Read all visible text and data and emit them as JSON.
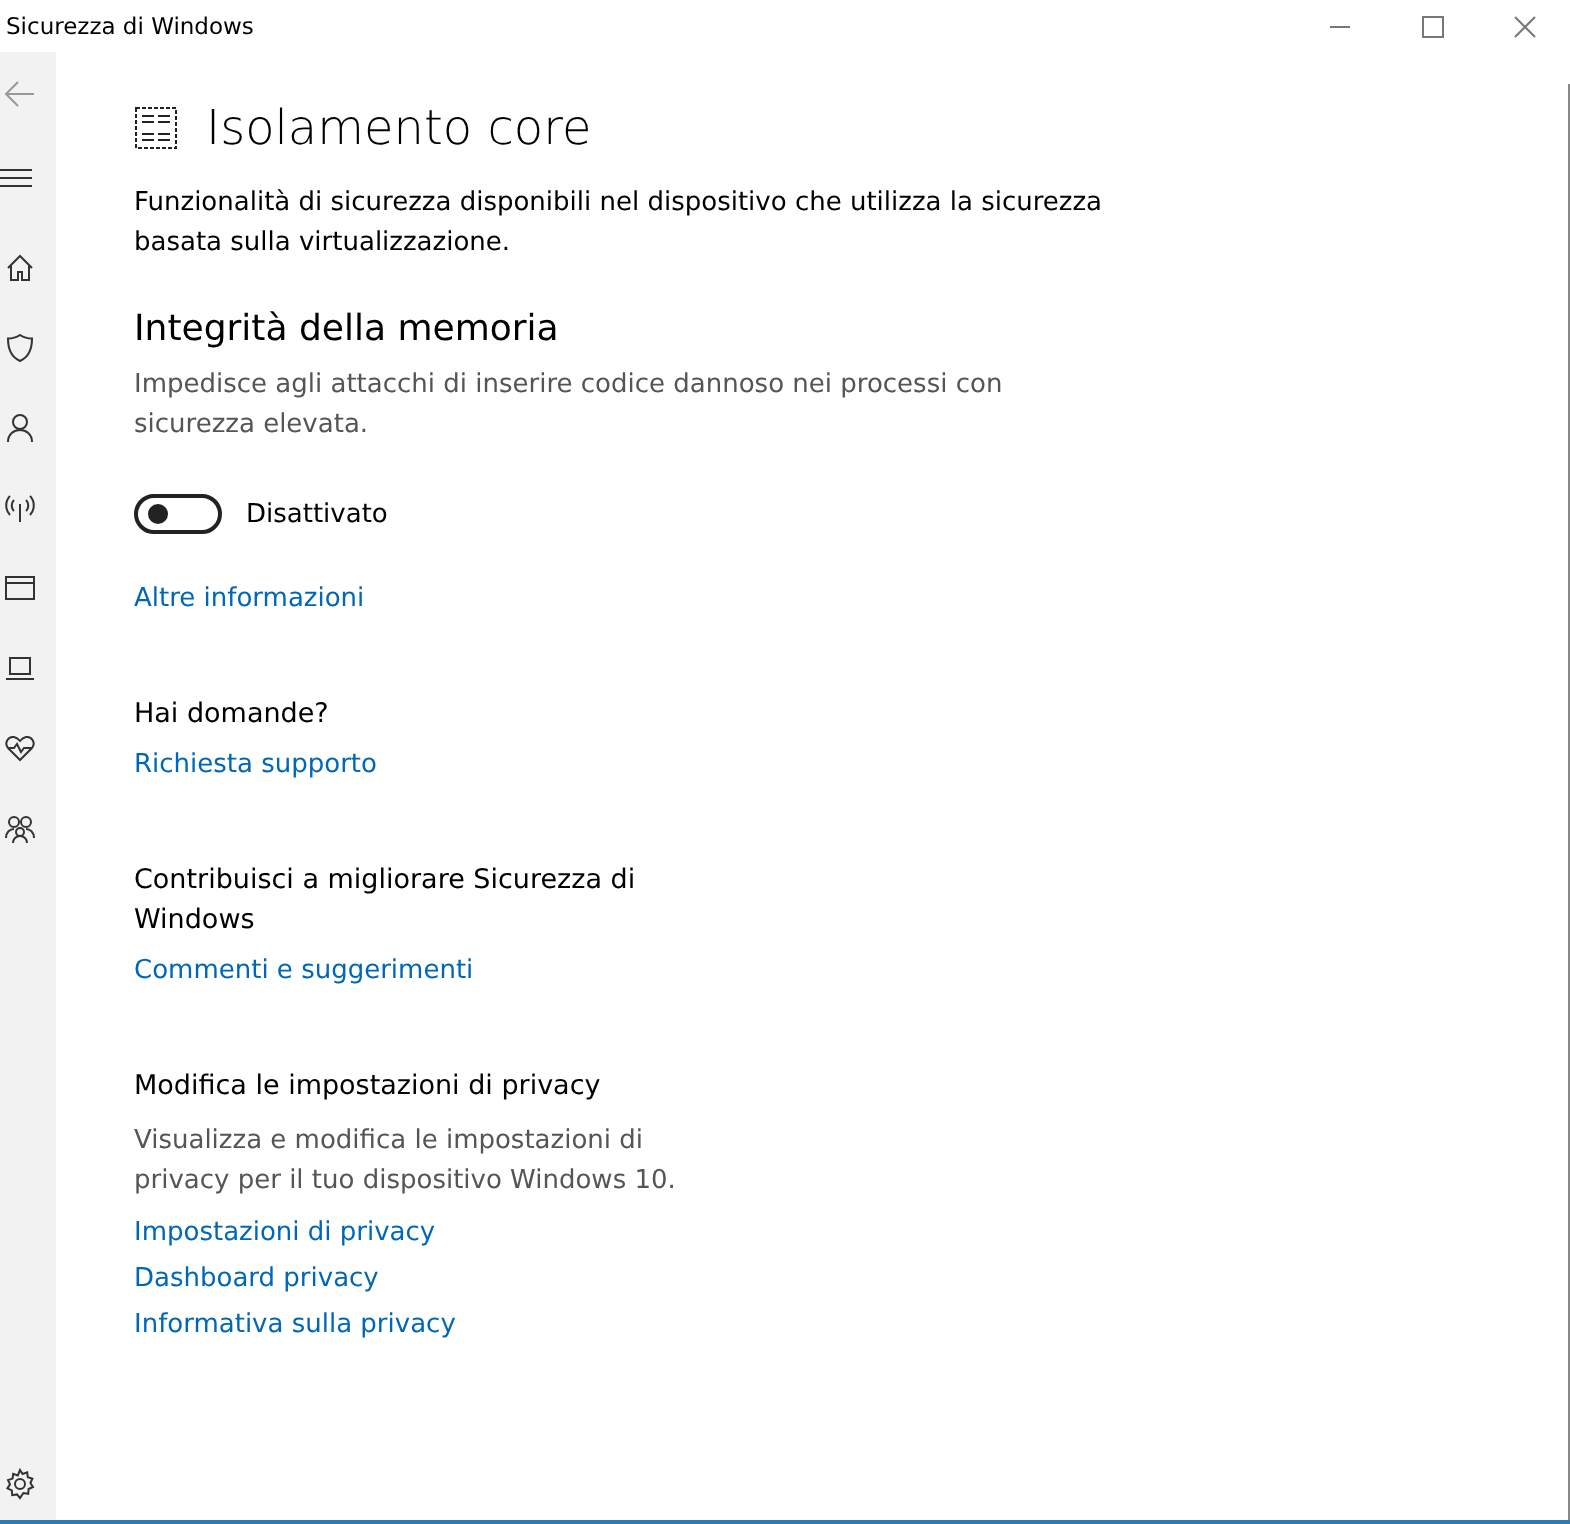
{
  "window": {
    "title": "Sicurezza di Windows"
  },
  "page": {
    "title": "Isolamento core",
    "description": "Funzionalità di sicurezza disponibili nel dispositivo che utilizza la sicurezza basata sulla virtualizzazione.",
    "section": {
      "title": "Integrità della memoria",
      "description": "Impedisce agli attacchi di inserire codice dannoso nei processi con sicurezza elevata.",
      "toggle": {
        "on": false,
        "label": "Disattivato"
      },
      "link": "Altre informazioni"
    }
  },
  "aside": [
    {
      "title": "Hai domande?",
      "links": [
        "Richiesta supporto"
      ]
    },
    {
      "title": "Contribuisci a migliorare Sicurezza di Windows",
      "links": [
        "Commenti e suggerimenti"
      ]
    },
    {
      "title": "Modifica le impostazioni di privacy",
      "description": "Visualizza e modifica le impostazioni di privacy per il tuo dispositivo Windows 10.",
      "links": [
        "Impostazioni di privacy",
        "Dashboard privacy",
        "Informativa sulla privacy"
      ]
    }
  ]
}
